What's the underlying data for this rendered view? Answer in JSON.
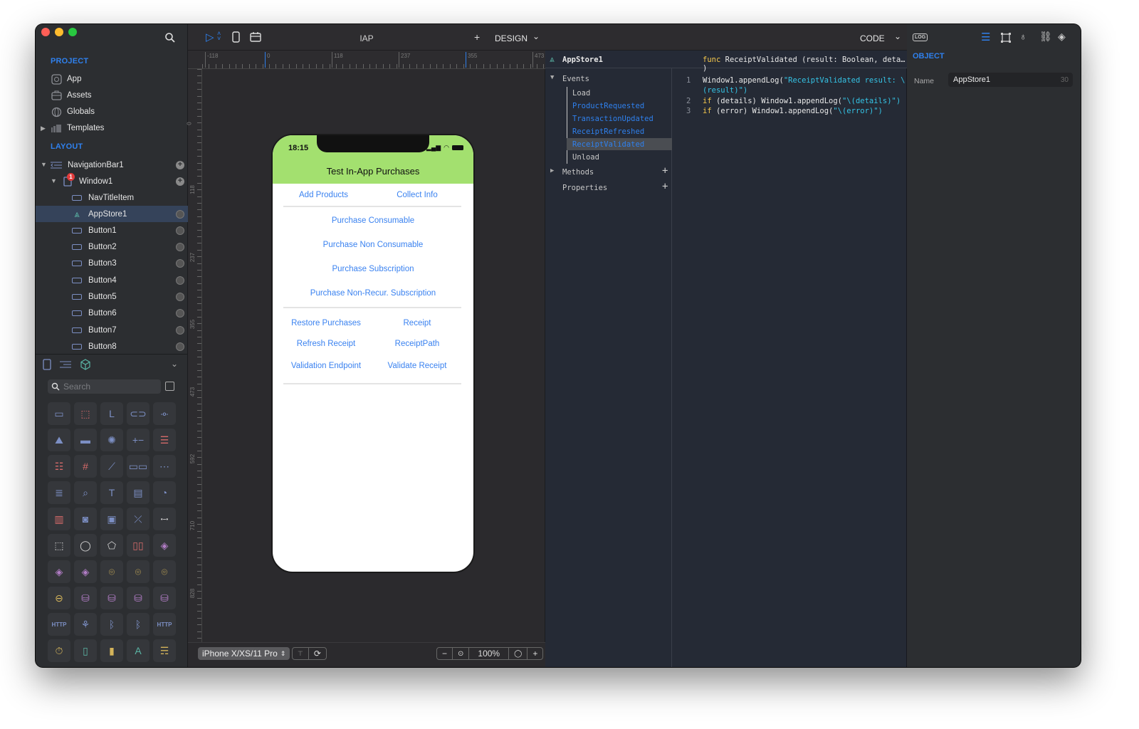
{
  "app": {
    "traffic_lights": {
      "close": "#ff5f57",
      "minimize": "#febc2e",
      "zoom": "#28c840"
    }
  },
  "sidebar": {
    "project_title": "PROJECT",
    "project_items": [
      {
        "label": "App",
        "icon": "app-icon"
      },
      {
        "label": "Assets",
        "icon": "briefcase-icon"
      },
      {
        "label": "Globals",
        "icon": "globe-icon"
      },
      {
        "label": "Templates",
        "icon": "templates-icon"
      }
    ],
    "layout_title": "LAYOUT",
    "tree": [
      {
        "label": "NavigationBar1",
        "level": 0,
        "icon": "navbar-icon"
      },
      {
        "label": "Window1",
        "level": 1,
        "icon": "window-icon",
        "badge": "1"
      },
      {
        "label": "NavTitleItem",
        "level": 2,
        "icon": "button-shape-icon"
      },
      {
        "label": "AppStore1",
        "level": 2,
        "icon": "appstore-icon",
        "selected": true
      },
      {
        "label": "Button1",
        "level": 2,
        "icon": "button-shape-icon"
      },
      {
        "label": "Button2",
        "level": 2,
        "icon": "button-shape-icon"
      },
      {
        "label": "Button3",
        "level": 2,
        "icon": "button-shape-icon"
      },
      {
        "label": "Button4",
        "level": 2,
        "icon": "button-shape-icon"
      },
      {
        "label": "Button5",
        "level": 2,
        "icon": "button-shape-icon"
      },
      {
        "label": "Button6",
        "level": 2,
        "icon": "button-shape-icon"
      },
      {
        "label": "Button7",
        "level": 2,
        "icon": "button-shape-icon"
      },
      {
        "label": "Button8",
        "level": 2,
        "icon": "button-shape-icon"
      }
    ],
    "library": {
      "search_placeholder": "Search",
      "items": [
        {
          "icon": "button-obj-icon",
          "glyph": "▭",
          "color": "#7c8fc4"
        },
        {
          "icon": "view-obj-icon",
          "glyph": "⬚",
          "color": "#d46a6a"
        },
        {
          "icon": "label-obj-icon",
          "glyph": "L",
          "color": "#7c8fc4"
        },
        {
          "icon": "switch-obj-icon",
          "glyph": "⊂⊃",
          "color": "#7c8fc4"
        },
        {
          "icon": "slider-obj-icon",
          "glyph": "-o-",
          "color": "#7c8fc4"
        },
        {
          "icon": "image-obj-icon",
          "glyph": "⛰",
          "color": "#7c8fc4"
        },
        {
          "icon": "progress-obj-icon",
          "glyph": "▬",
          "color": "#7c8fc4"
        },
        {
          "icon": "spinner-obj-icon",
          "glyph": "✺",
          "color": "#7c8fc4"
        },
        {
          "icon": "stepper-obj-icon",
          "glyph": "+−",
          "color": "#7c8fc4"
        },
        {
          "icon": "segment-obj-icon",
          "glyph": "☰",
          "color": "#d46a6a"
        },
        {
          "icon": "table-obj-icon",
          "glyph": "☷",
          "color": "#d46a6a"
        },
        {
          "icon": "grid-obj-icon",
          "glyph": "#",
          "color": "#d46a6a"
        },
        {
          "icon": "compass-obj-icon",
          "glyph": "⟋",
          "color": "#7c8fc4"
        },
        {
          "icon": "segmented-obj-icon",
          "glyph": "▭▭",
          "color": "#7c8fc4"
        },
        {
          "icon": "picker-obj-icon",
          "glyph": "⋯",
          "color": "#7c8fc4"
        },
        {
          "icon": "text-obj-icon",
          "glyph": "≣",
          "color": "#7c8fc4"
        },
        {
          "icon": "search-obj-icon",
          "glyph": "⌕",
          "color": "#7c8fc4"
        },
        {
          "icon": "textfield-obj-icon",
          "glyph": "T",
          "color": "#7c8fc4"
        },
        {
          "icon": "webview-obj-icon",
          "glyph": "▤",
          "color": "#7c8fc4"
        },
        {
          "icon": "chart-obj-icon",
          "glyph": "◔",
          "color": "#7c8fc4"
        },
        {
          "icon": "carousel-obj-icon",
          "glyph": "▥",
          "color": "#d46a6a"
        },
        {
          "icon": "camera-obj-icon",
          "glyph": "◙",
          "color": "#7c8fc4"
        },
        {
          "icon": "video-obj-icon",
          "glyph": "▣",
          "color": "#7c8fc4"
        },
        {
          "icon": "path-obj-icon",
          "glyph": "⤫",
          "color": "#7c8fc4"
        },
        {
          "icon": "connector-obj-icon",
          "glyph": "•−•",
          "color": "#cfcfcf"
        },
        {
          "icon": "rect-shape-icon",
          "glyph": "⬚",
          "color": "#cfcfcf"
        },
        {
          "icon": "circle-shape-icon",
          "glyph": "◯",
          "color": "#cfcfcf"
        },
        {
          "icon": "polygon-shape-icon",
          "glyph": "⬠",
          "color": "#cfcfcf"
        },
        {
          "icon": "pages-obj-icon",
          "glyph": "▯▯",
          "color": "#d46a6a"
        },
        {
          "icon": "layers-obj-icon",
          "glyph": "◈",
          "color": "#b07cc4"
        },
        {
          "icon": "layers2-obj-icon",
          "glyph": "◈",
          "color": "#b07cc4"
        },
        {
          "icon": "layers3-obj-icon",
          "glyph": "◈",
          "color": "#b07cc4"
        },
        {
          "icon": "location-obj-icon",
          "glyph": "⌾",
          "color": "#d4b45a"
        },
        {
          "icon": "location2-obj-icon",
          "glyph": "⌾",
          "color": "#d4b45a"
        },
        {
          "icon": "location3-obj-icon",
          "glyph": "⌾",
          "color": "#d4b45a"
        },
        {
          "icon": "gyro-obj-icon",
          "glyph": "⊖",
          "color": "#d4b45a"
        },
        {
          "icon": "db-obj-icon",
          "glyph": "⛁",
          "color": "#b07cc4"
        },
        {
          "icon": "db2-obj-icon",
          "glyph": "⛁",
          "color": "#b07cc4"
        },
        {
          "icon": "db3-obj-icon",
          "glyph": "⛁",
          "color": "#b07cc4"
        },
        {
          "icon": "db4-obj-icon",
          "glyph": "⛁",
          "color": "#b07cc4"
        },
        {
          "icon": "http-down-obj-icon",
          "glyph": "HTTP",
          "color": "#7c8fc4"
        },
        {
          "icon": "network-obj-icon",
          "glyph": "⚘",
          "color": "#7c8fc4"
        },
        {
          "icon": "bluetooth-obj-icon",
          "glyph": "ᛒ",
          "color": "#7c8fc4"
        },
        {
          "icon": "bluetooth2-obj-icon",
          "glyph": "ᛒ",
          "color": "#7c8fc4"
        },
        {
          "icon": "http-up-obj-icon",
          "glyph": "HTTP",
          "color": "#7c8fc4"
        },
        {
          "icon": "timer-obj-icon",
          "glyph": "⏱",
          "color": "#d4b45a"
        },
        {
          "icon": "battery-obj-icon",
          "glyph": "▯",
          "color": "#5ab4a4"
        },
        {
          "icon": "device-obj-icon",
          "glyph": "▮",
          "color": "#d4b45a"
        },
        {
          "icon": "appstore-obj-icon",
          "glyph": "A",
          "color": "#5ab4a4"
        },
        {
          "icon": "drawer-obj-icon",
          "glyph": "☴",
          "color": "#d4b45a"
        }
      ]
    }
  },
  "design": {
    "title": "IAP",
    "mode_label": "DESIGN",
    "ruler_h": [
      "-118",
      "0",
      "118",
      "237",
      "355",
      "473"
    ],
    "ruler_v": [
      "0",
      "118",
      "237",
      "355",
      "473",
      "592",
      "710",
      "828"
    ],
    "device": "iPhone X/XS/11 Pro",
    "zoom": "100%",
    "phone": {
      "time": "18:15",
      "nav_title": "Test In-App Purchases",
      "nav_color": "#a3e06f",
      "link_color": "#3a82f0",
      "row1": [
        "Add Products",
        "Collect Info"
      ],
      "purchases": [
        "Purchase Consumable",
        "Purchase Non Consumable",
        "Purchase Subscription",
        "Purchase Non-Recur. Subscription"
      ],
      "grid": [
        [
          "Restore Purchases",
          "Receipt"
        ],
        [
          "Refresh Receipt",
          "ReceiptPath"
        ],
        [
          "Validation Endpoint",
          "Validate Receipt"
        ]
      ]
    }
  },
  "code": {
    "mode_label": "CODE",
    "object": "AppStore1",
    "signature_kw": "func",
    "signature": "ReceiptValidated (result: Boolean, deta… )",
    "tree": {
      "events_label": "Events",
      "events": [
        {
          "label": "Load",
          "active": false
        },
        {
          "label": "ProductRequested",
          "active": true
        },
        {
          "label": "TransactionUpdated",
          "active": true
        },
        {
          "label": "ReceiptRefreshed",
          "active": true
        },
        {
          "label": "ReceiptValidated",
          "active": true,
          "selected": true
        },
        {
          "label": "Unload",
          "active": false
        }
      ],
      "methods_label": "Methods",
      "properties_label": "Properties"
    },
    "lines": [
      {
        "n": "1",
        "a": "Window1",
        "b": ".appendLog(",
        "s": "\"ReceiptValidated result: \\",
        "c": ""
      },
      {
        "n": "",
        "a": "",
        "b": "",
        "s": "(result)\")",
        "c": ""
      },
      {
        "n": "2",
        "a": "if",
        "b": " (details) Window1.appendLog(",
        "s": "\"\\(details)\")",
        "c": ""
      },
      {
        "n": "3",
        "a": "if",
        "b": " (error) Window1.appendLog(",
        "s": "\"\\(error)\")",
        "c": ""
      }
    ]
  },
  "inspector": {
    "log_label": "LOG",
    "section": "OBJECT",
    "name_label": "Name",
    "name_value": "AppStore1",
    "name_count": "30"
  }
}
